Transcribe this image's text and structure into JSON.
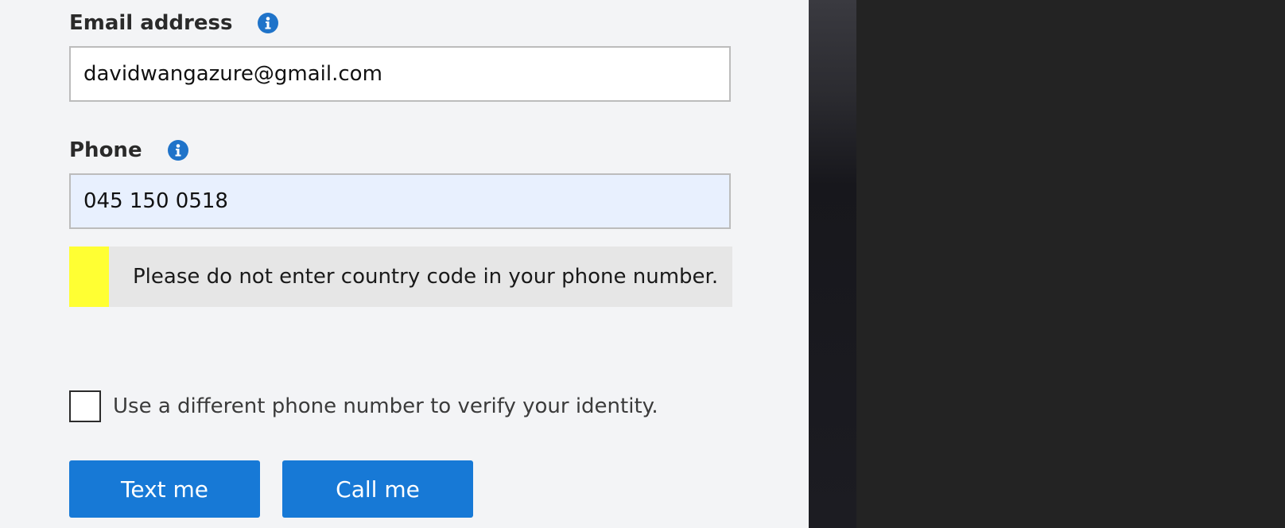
{
  "form": {
    "email": {
      "label": "Email address",
      "value": "davidwangazure@gmail.com",
      "icon": "info-icon"
    },
    "phone": {
      "label": "Phone",
      "value": "045 150 0518",
      "icon": "info-icon"
    },
    "notice": {
      "text": "Please do not enter country code in your phone number.",
      "accent_color": "#ffff33"
    },
    "different_phone": {
      "label": "Use a different phone number to verify your identity.",
      "checked": false
    },
    "buttons": {
      "text_me": "Text me",
      "call_me": "Call me"
    }
  },
  "colors": {
    "primary": "#1779d6",
    "info_icon": "#1f73c9",
    "panel_background": "#f3f4f6",
    "dark_background": "#232323"
  }
}
